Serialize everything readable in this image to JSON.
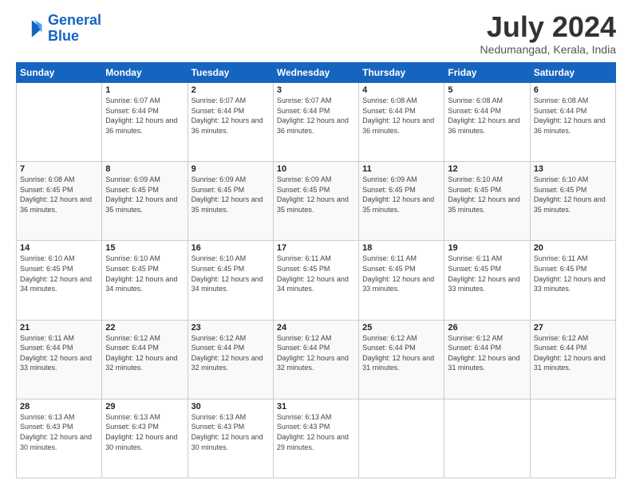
{
  "logo": {
    "line1": "General",
    "line2": "Blue"
  },
  "title": "July 2024",
  "subtitle": "Nedumangad, Kerala, India",
  "days_of_week": [
    "Sunday",
    "Monday",
    "Tuesday",
    "Wednesday",
    "Thursday",
    "Friday",
    "Saturday"
  ],
  "weeks": [
    [
      {
        "day": "",
        "sunrise": "",
        "sunset": "",
        "daylight": ""
      },
      {
        "day": "1",
        "sunrise": "Sunrise: 6:07 AM",
        "sunset": "Sunset: 6:44 PM",
        "daylight": "Daylight: 12 hours and 36 minutes."
      },
      {
        "day": "2",
        "sunrise": "Sunrise: 6:07 AM",
        "sunset": "Sunset: 6:44 PM",
        "daylight": "Daylight: 12 hours and 36 minutes."
      },
      {
        "day": "3",
        "sunrise": "Sunrise: 6:07 AM",
        "sunset": "Sunset: 6:44 PM",
        "daylight": "Daylight: 12 hours and 36 minutes."
      },
      {
        "day": "4",
        "sunrise": "Sunrise: 6:08 AM",
        "sunset": "Sunset: 6:44 PM",
        "daylight": "Daylight: 12 hours and 36 minutes."
      },
      {
        "day": "5",
        "sunrise": "Sunrise: 6:08 AM",
        "sunset": "Sunset: 6:44 PM",
        "daylight": "Daylight: 12 hours and 36 minutes."
      },
      {
        "day": "6",
        "sunrise": "Sunrise: 6:08 AM",
        "sunset": "Sunset: 6:44 PM",
        "daylight": "Daylight: 12 hours and 36 minutes."
      }
    ],
    [
      {
        "day": "7",
        "sunrise": "Sunrise: 6:08 AM",
        "sunset": "Sunset: 6:45 PM",
        "daylight": "Daylight: 12 hours and 36 minutes."
      },
      {
        "day": "8",
        "sunrise": "Sunrise: 6:09 AM",
        "sunset": "Sunset: 6:45 PM",
        "daylight": "Daylight: 12 hours and 35 minutes."
      },
      {
        "day": "9",
        "sunrise": "Sunrise: 6:09 AM",
        "sunset": "Sunset: 6:45 PM",
        "daylight": "Daylight: 12 hours and 35 minutes."
      },
      {
        "day": "10",
        "sunrise": "Sunrise: 6:09 AM",
        "sunset": "Sunset: 6:45 PM",
        "daylight": "Daylight: 12 hours and 35 minutes."
      },
      {
        "day": "11",
        "sunrise": "Sunrise: 6:09 AM",
        "sunset": "Sunset: 6:45 PM",
        "daylight": "Daylight: 12 hours and 35 minutes."
      },
      {
        "day": "12",
        "sunrise": "Sunrise: 6:10 AM",
        "sunset": "Sunset: 6:45 PM",
        "daylight": "Daylight: 12 hours and 35 minutes."
      },
      {
        "day": "13",
        "sunrise": "Sunrise: 6:10 AM",
        "sunset": "Sunset: 6:45 PM",
        "daylight": "Daylight: 12 hours and 35 minutes."
      }
    ],
    [
      {
        "day": "14",
        "sunrise": "Sunrise: 6:10 AM",
        "sunset": "Sunset: 6:45 PM",
        "daylight": "Daylight: 12 hours and 34 minutes."
      },
      {
        "day": "15",
        "sunrise": "Sunrise: 6:10 AM",
        "sunset": "Sunset: 6:45 PM",
        "daylight": "Daylight: 12 hours and 34 minutes."
      },
      {
        "day": "16",
        "sunrise": "Sunrise: 6:10 AM",
        "sunset": "Sunset: 6:45 PM",
        "daylight": "Daylight: 12 hours and 34 minutes."
      },
      {
        "day": "17",
        "sunrise": "Sunrise: 6:11 AM",
        "sunset": "Sunset: 6:45 PM",
        "daylight": "Daylight: 12 hours and 34 minutes."
      },
      {
        "day": "18",
        "sunrise": "Sunrise: 6:11 AM",
        "sunset": "Sunset: 6:45 PM",
        "daylight": "Daylight: 12 hours and 33 minutes."
      },
      {
        "day": "19",
        "sunrise": "Sunrise: 6:11 AM",
        "sunset": "Sunset: 6:45 PM",
        "daylight": "Daylight: 12 hours and 33 minutes."
      },
      {
        "day": "20",
        "sunrise": "Sunrise: 6:11 AM",
        "sunset": "Sunset: 6:45 PM",
        "daylight": "Daylight: 12 hours and 33 minutes."
      }
    ],
    [
      {
        "day": "21",
        "sunrise": "Sunrise: 6:11 AM",
        "sunset": "Sunset: 6:44 PM",
        "daylight": "Daylight: 12 hours and 33 minutes."
      },
      {
        "day": "22",
        "sunrise": "Sunrise: 6:12 AM",
        "sunset": "Sunset: 6:44 PM",
        "daylight": "Daylight: 12 hours and 32 minutes."
      },
      {
        "day": "23",
        "sunrise": "Sunrise: 6:12 AM",
        "sunset": "Sunset: 6:44 PM",
        "daylight": "Daylight: 12 hours and 32 minutes."
      },
      {
        "day": "24",
        "sunrise": "Sunrise: 6:12 AM",
        "sunset": "Sunset: 6:44 PM",
        "daylight": "Daylight: 12 hours and 32 minutes."
      },
      {
        "day": "25",
        "sunrise": "Sunrise: 6:12 AM",
        "sunset": "Sunset: 6:44 PM",
        "daylight": "Daylight: 12 hours and 31 minutes."
      },
      {
        "day": "26",
        "sunrise": "Sunrise: 6:12 AM",
        "sunset": "Sunset: 6:44 PM",
        "daylight": "Daylight: 12 hours and 31 minutes."
      },
      {
        "day": "27",
        "sunrise": "Sunrise: 6:12 AM",
        "sunset": "Sunset: 6:44 PM",
        "daylight": "Daylight: 12 hours and 31 minutes."
      }
    ],
    [
      {
        "day": "28",
        "sunrise": "Sunrise: 6:13 AM",
        "sunset": "Sunset: 6:43 PM",
        "daylight": "Daylight: 12 hours and 30 minutes."
      },
      {
        "day": "29",
        "sunrise": "Sunrise: 6:13 AM",
        "sunset": "Sunset: 6:43 PM",
        "daylight": "Daylight: 12 hours and 30 minutes."
      },
      {
        "day": "30",
        "sunrise": "Sunrise: 6:13 AM",
        "sunset": "Sunset: 6:43 PM",
        "daylight": "Daylight: 12 hours and 30 minutes."
      },
      {
        "day": "31",
        "sunrise": "Sunrise: 6:13 AM",
        "sunset": "Sunset: 6:43 PM",
        "daylight": "Daylight: 12 hours and 29 minutes."
      },
      {
        "day": "",
        "sunrise": "",
        "sunset": "",
        "daylight": ""
      },
      {
        "day": "",
        "sunrise": "",
        "sunset": "",
        "daylight": ""
      },
      {
        "day": "",
        "sunrise": "",
        "sunset": "",
        "daylight": ""
      }
    ]
  ]
}
